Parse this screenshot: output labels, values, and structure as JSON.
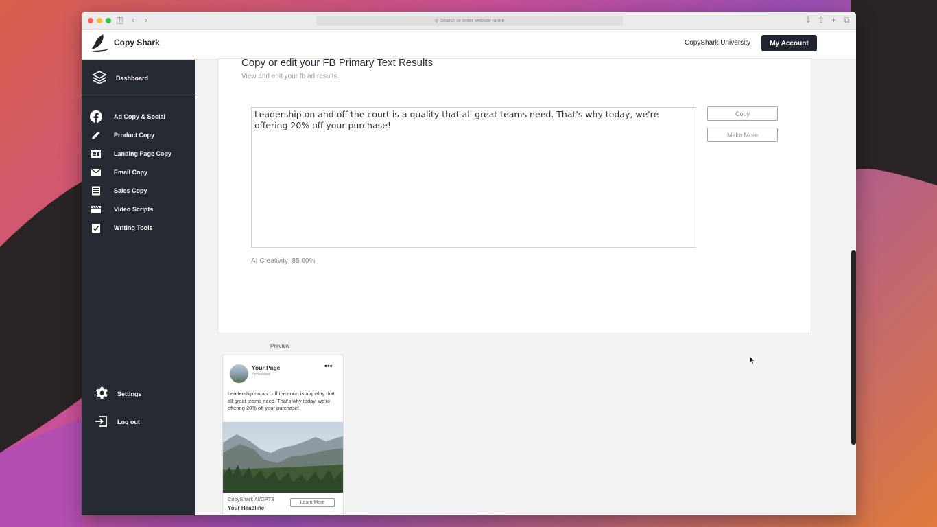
{
  "browser": {
    "url_placeholder": "Search or enter website name"
  },
  "header": {
    "brand": "Copy Shark",
    "university_link": "CopyShark University",
    "account_button": "My Account"
  },
  "sidebar": {
    "dashboard": "Dashboard",
    "items": [
      {
        "label": "Ad Copy & Social",
        "icon": "facebook-icon"
      },
      {
        "label": "Product Copy",
        "icon": "pencil-icon"
      },
      {
        "label": "Landing Page Copy",
        "icon": "landing-page-icon"
      },
      {
        "label": "Email Copy",
        "icon": "envelope-icon"
      },
      {
        "label": "Sales Copy",
        "icon": "document-icon"
      },
      {
        "label": "Video Scripts",
        "icon": "clapperboard-icon"
      },
      {
        "label": "Writing Tools",
        "icon": "checklist-icon"
      }
    ],
    "settings": "Settings",
    "logout": "Log out"
  },
  "results": {
    "title": "Copy or edit your FB Primary Text Results",
    "subtitle": "View and edit your fb ad results.",
    "text": " Leadership on and off the court is a quality that all great teams need. That's why today, we're offering 20% off your purchase!",
    "copy_button": "Copy",
    "make_more_button": "Make More",
    "creativity_label": "AI Creativity:",
    "creativity_value": "85.00%"
  },
  "preview": {
    "label": "Preview",
    "page_name": "Your Page",
    "sponsored": "Sponsored",
    "dots": "•••",
    "body": "Leadership on and off the court is a quality that all great teams need. That's why today, we're offering 20% off your purchase!",
    "source": "CopyShark AI/GPT3",
    "headline": "Your Headline",
    "cta": "Learn More"
  }
}
